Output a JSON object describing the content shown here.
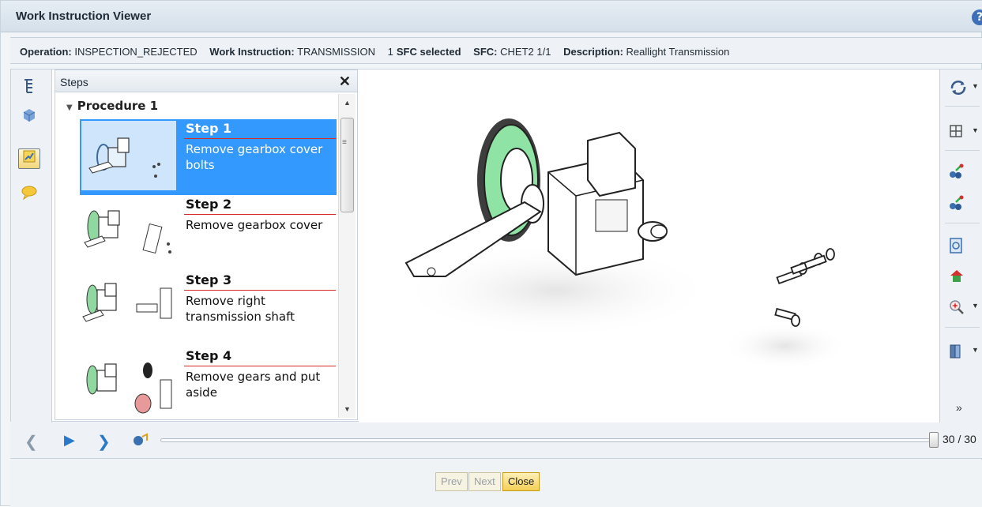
{
  "window": {
    "title": "Work Instruction Viewer",
    "help_glyph": "?"
  },
  "infobar": {
    "operation_label": "Operation:",
    "operation_value": "INSPECTION_REJECTED",
    "wi_label": "Work Instruction:",
    "wi_value": "TRANSMISSION",
    "sfc_count": "1",
    "sfc_selected_label": "SFC selected",
    "sfc_label": "SFC:",
    "sfc_value": "CHET2 1/1",
    "desc_label": "Description:",
    "desc_value": "Reallight Transmission"
  },
  "left_tools": [
    {
      "icon": "tree-icon"
    },
    {
      "icon": "cube-icon"
    },
    {
      "icon": "steps-icon",
      "active": true
    },
    {
      "icon": "comment-icon"
    }
  ],
  "steps_panel": {
    "title": "Steps",
    "close_glyph": "✕",
    "procedure": "Procedure 1",
    "steps": [
      {
        "num": "Step 1",
        "desc": "Remove gearbox cover bolts",
        "selected": true
      },
      {
        "num": "Step 2",
        "desc": "Remove gearbox cover",
        "selected": false
      },
      {
        "num": "Step 3",
        "desc": "Remove right transmission shaft",
        "selected": false
      },
      {
        "num": "Step 4",
        "desc": "Remove gears and put aside",
        "selected": false
      }
    ]
  },
  "right_tools": [
    "rotate-icon",
    "grid-icon",
    "explode-icon",
    "collapse-icon",
    "page-icon",
    "home-icon",
    "zoom-icon",
    "book-icon",
    "more-icon"
  ],
  "timeline": {
    "counter": "30 / 30",
    "progress": 1.0
  },
  "footer": {
    "prev": "Prev",
    "next": "Next",
    "close": "Close"
  },
  "colors": {
    "selection": "#3399ff",
    "accent_red": "#d42a2a",
    "gear_green": "#6fd28a"
  }
}
